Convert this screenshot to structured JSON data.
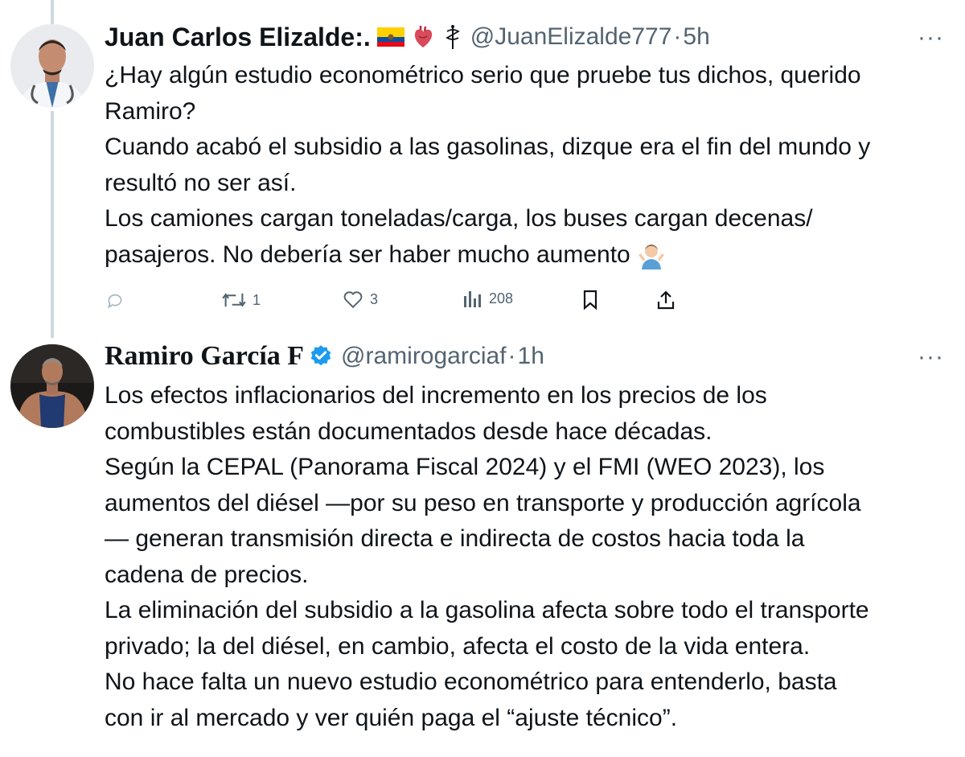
{
  "tweets": [
    {
      "author_name": "Juan Carlos Elizalde:.",
      "handle": "@JuanElizalde777",
      "separator": "·",
      "time": "5h",
      "more": "···",
      "badges": [
        "ecuador-flag-icon",
        "anatomical-heart-icon",
        "medical-staff-icon"
      ],
      "text_lines": [
        "¿Hay algún estudio econométrico serio que pruebe tus dichos, querido",
        "Ramiro?",
        "Cuando acabó el subsidio a las gasolinas, dizque era el fin del mundo y",
        "resultó no ser así.",
        "Los camiones cargan toneladas/carga, los buses cargan decenas/",
        "pasajeros. No debería ser haber mucho aumento"
      ],
      "actions": {
        "reply_count": "",
        "retweet_count": "1",
        "like_count": "3",
        "views_count": "208"
      }
    },
    {
      "author_name": "Ramiro García F",
      "handle": "@ramirogarciaf",
      "separator": "·",
      "time": "1h",
      "more": "···",
      "verified": true,
      "text_lines": [
        "Los efectos inflacionarios del incremento en los precios de los",
        "combustibles están documentados desde hace décadas.",
        "Según la CEPAL (Panorama Fiscal 2024) y el FMI (WEO 2023), los",
        "aumentos del diésel —por su peso en transporte y producción agrícola",
        "— generan transmisión directa e indirecta de costos hacia toda la",
        "cadena de precios.",
        "La eliminación del subsidio a la gasolina afecta sobre todo el transporte",
        "privado; la del diésel, en cambio, afecta el costo de la vida entera.",
        "No hace falta un nuevo estudio econométrico para entenderlo, basta",
        "con ir al mercado y ver quién paga el “ajuste técnico”."
      ]
    }
  ],
  "colors": {
    "text": "#0f1419",
    "secondary": "#536471",
    "thread_line": "#cfd9de",
    "verified": "#1d9bf0"
  }
}
